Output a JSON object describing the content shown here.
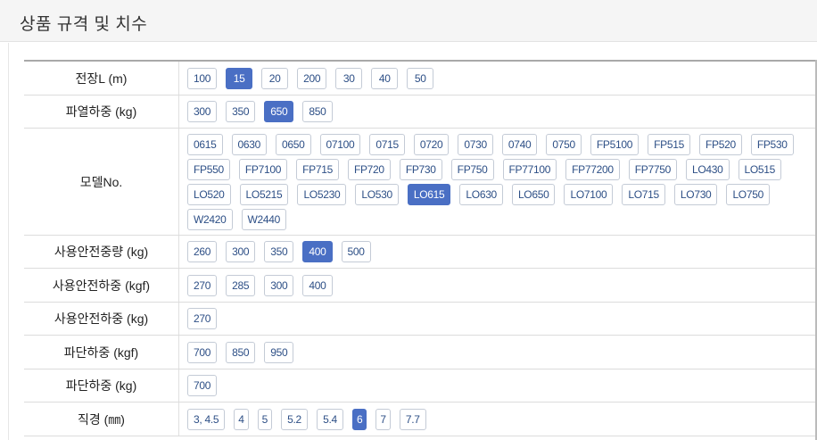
{
  "header": {
    "title": "상품 규격 및 치수"
  },
  "rows": [
    {
      "label": "전장L (m)",
      "height": 38,
      "options": [
        "100",
        "15",
        "20",
        "200",
        "30",
        "40",
        "50"
      ],
      "selected": "15"
    },
    {
      "label": "파열하중 (kg)",
      "height": 37,
      "options": [
        "300",
        "350",
        "650",
        "850"
      ],
      "selected": "650"
    },
    {
      "label": "모델No.",
      "height": 120,
      "options": [
        "0615",
        "0630",
        "0650",
        "07100",
        "0715",
        "0720",
        "0730",
        "0740",
        "0750",
        "FP5100",
        "FP515",
        "FP520",
        "FP530",
        "FP550",
        "FP7100",
        "FP715",
        "FP720",
        "FP730",
        "FP750",
        "FP77100",
        "FP77200",
        "FP7750",
        "LO430",
        "LO515",
        "LO520",
        "LO5215",
        "LO5230",
        "LO530",
        "LO615",
        "LO630",
        "LO650",
        "LO7100",
        "LO715",
        "LO730",
        "LO750",
        "W2420",
        "W2440"
      ],
      "selected": "LO615"
    },
    {
      "label": "사용안전중량 (kg)",
      "height": 37,
      "options": [
        "260",
        "300",
        "350",
        "400",
        "500"
      ],
      "selected": "400"
    },
    {
      "label": "사용안전하중 (kgf)",
      "height": 38,
      "options": [
        "270",
        "285",
        "300",
        "400"
      ],
      "selected": ""
    },
    {
      "label": "사용안전하중 (kg)",
      "height": 37,
      "options": [
        "270"
      ],
      "selected": ""
    },
    {
      "label": "파단하중 (kgf)",
      "height": 38,
      "options": [
        "700",
        "850",
        "950"
      ],
      "selected": ""
    },
    {
      "label": "파단하중 (kg)",
      "height": 37,
      "options": [
        "700"
      ],
      "selected": ""
    },
    {
      "label": "직경 (㎜)",
      "height": 38,
      "options": [
        "3, 4.5",
        "4",
        "5",
        "5.2",
        "5.4",
        "6",
        "7",
        "7.7"
      ],
      "selected": "6"
    }
  ],
  "colors": {
    "selected_bg": "#4a6fc4",
    "option_text": "#2d4f86",
    "option_border": "#c4cbd6"
  }
}
